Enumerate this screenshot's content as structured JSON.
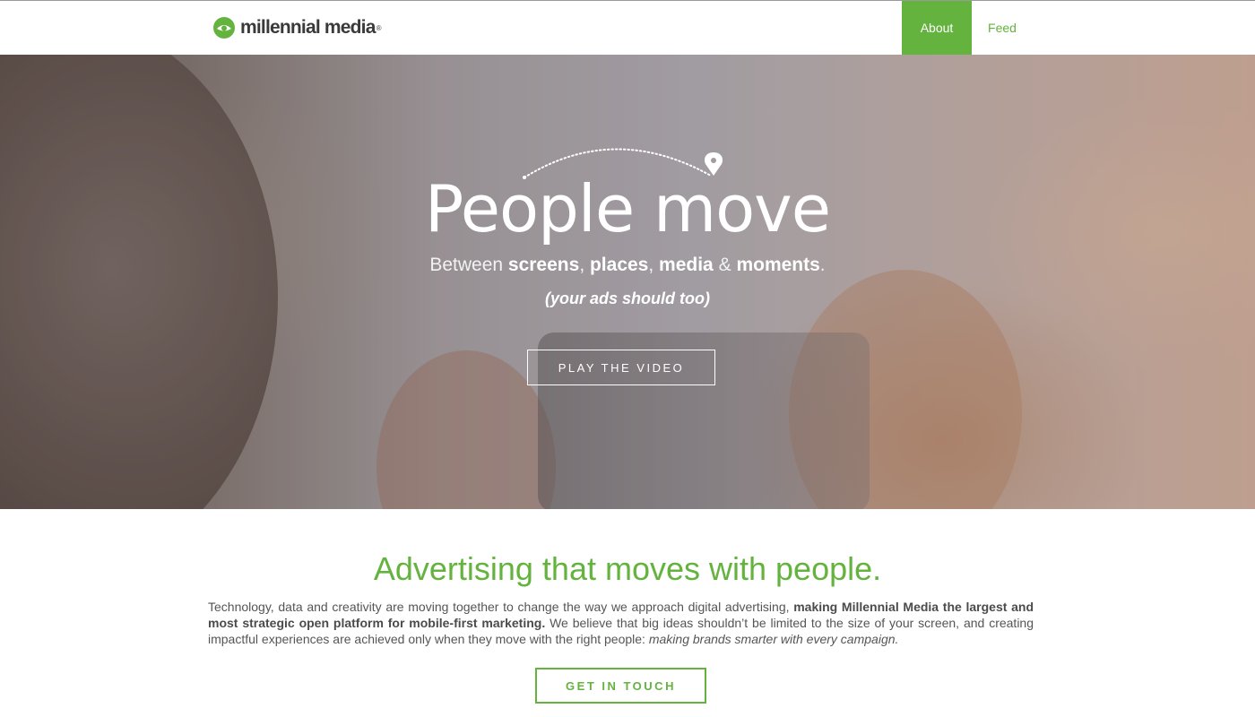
{
  "header": {
    "logo_text": "millennial media",
    "logo_mark": "®",
    "nav": {
      "about": "About",
      "feed": "Feed"
    }
  },
  "hero": {
    "title": "People move",
    "subtitle": {
      "prefix": "Between ",
      "screens": "screens",
      "sep1": ", ",
      "places": "places",
      "sep2": ", ",
      "media": "media",
      "amp": " & ",
      "moments": "moments",
      "end": "."
    },
    "parenthetical": "(your ads should too)",
    "play_button": "PLAY THE VIDEO"
  },
  "content": {
    "title": "Advertising that moves with people.",
    "paragraph": {
      "part1": "Technology, data and creativity are moving together to change the way we approach digital advertising, ",
      "bold": "making Millennial Media the largest and most strategic open platform for mobile-first marketing.",
      "part2": " We believe that big ideas shouldn’t be limited to the size of your screen, and creating impactful experiences are achieved only when they move with the right people: ",
      "italic": "making brands smarter with every campaign."
    },
    "cta_button": "GET IN TOUCH"
  },
  "colors": {
    "brand_green": "#63b33e",
    "text_gray": "#555555"
  },
  "icons": {
    "logo": "millennial-media-logo-icon",
    "location_pin": "location-pin-icon"
  }
}
